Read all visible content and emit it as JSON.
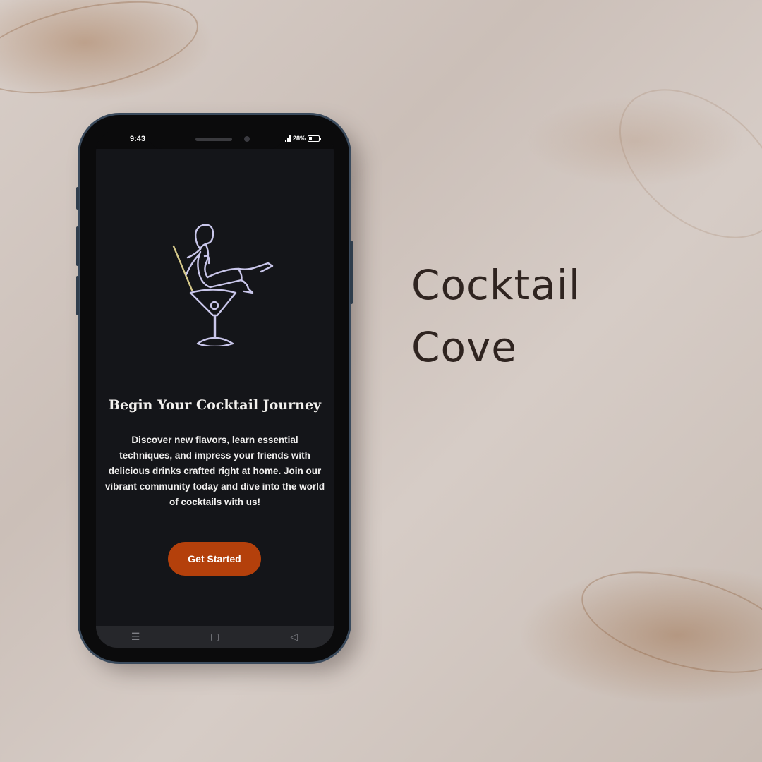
{
  "status_bar": {
    "time": "9:43",
    "battery": "28%"
  },
  "screen": {
    "logo_icon": "cocktail-lady-martini-icon",
    "title": "Begin Your Cocktail Journey",
    "description": "Discover new flavors, learn essential techniques, and impress your friends with delicious drinks crafted right at home. Join our vibrant community today and dive into the world of cocktails with us!",
    "cta_label": "Get Started"
  },
  "nav_bar": {
    "menu_glyph": "☰",
    "home_glyph": "▢",
    "back_glyph": "◁"
  },
  "brand": {
    "line1": "Cocktail",
    "line2": "Cove"
  },
  "colors": {
    "accent": "#b4400b",
    "screen_bg": "#141519",
    "brand_text": "#2f2420",
    "logo_stroke": "#c9c6ea"
  }
}
